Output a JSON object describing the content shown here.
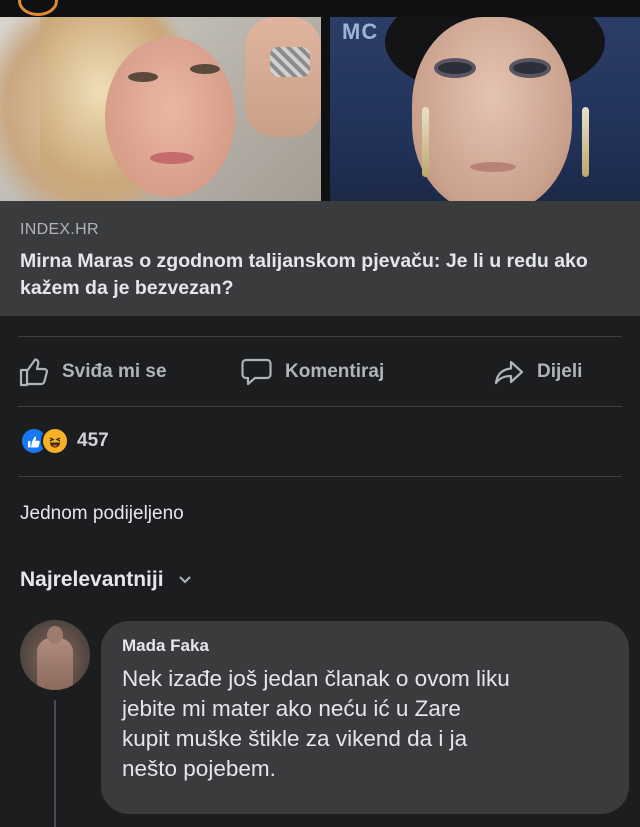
{
  "link_preview": {
    "source": "INDEX.HR",
    "headline": "Mirna Maras o zgodnom talijanskom pjevaču: Je li u redu ako kažem da je bezvezan?",
    "right_photo_text": "MC"
  },
  "actions": {
    "like": "Sviđa mi se",
    "comment": "Komentiraj",
    "share": "Dijeli"
  },
  "reactions": {
    "count": "457",
    "types": [
      "like",
      "haha"
    ]
  },
  "shares": {
    "label": "Jednom podijeljeno"
  },
  "comments_filter": {
    "label": "Najrelevantniji"
  },
  "comment": {
    "author": "Mada Faka",
    "text": "Nek izađe još jedan članak o ovom liku\njebite mi mater ako neću ić u Zare\nkupit muške štikle za vikend da i ja\nnešto pojebem."
  },
  "colors": {
    "background": "#1c1d1f",
    "card": "#3a3b3d",
    "text_primary": "#e4e6eb",
    "text_secondary": "#b0b3b8",
    "like_blue": "#1877f2",
    "haha_yellow": "#f7b125"
  }
}
